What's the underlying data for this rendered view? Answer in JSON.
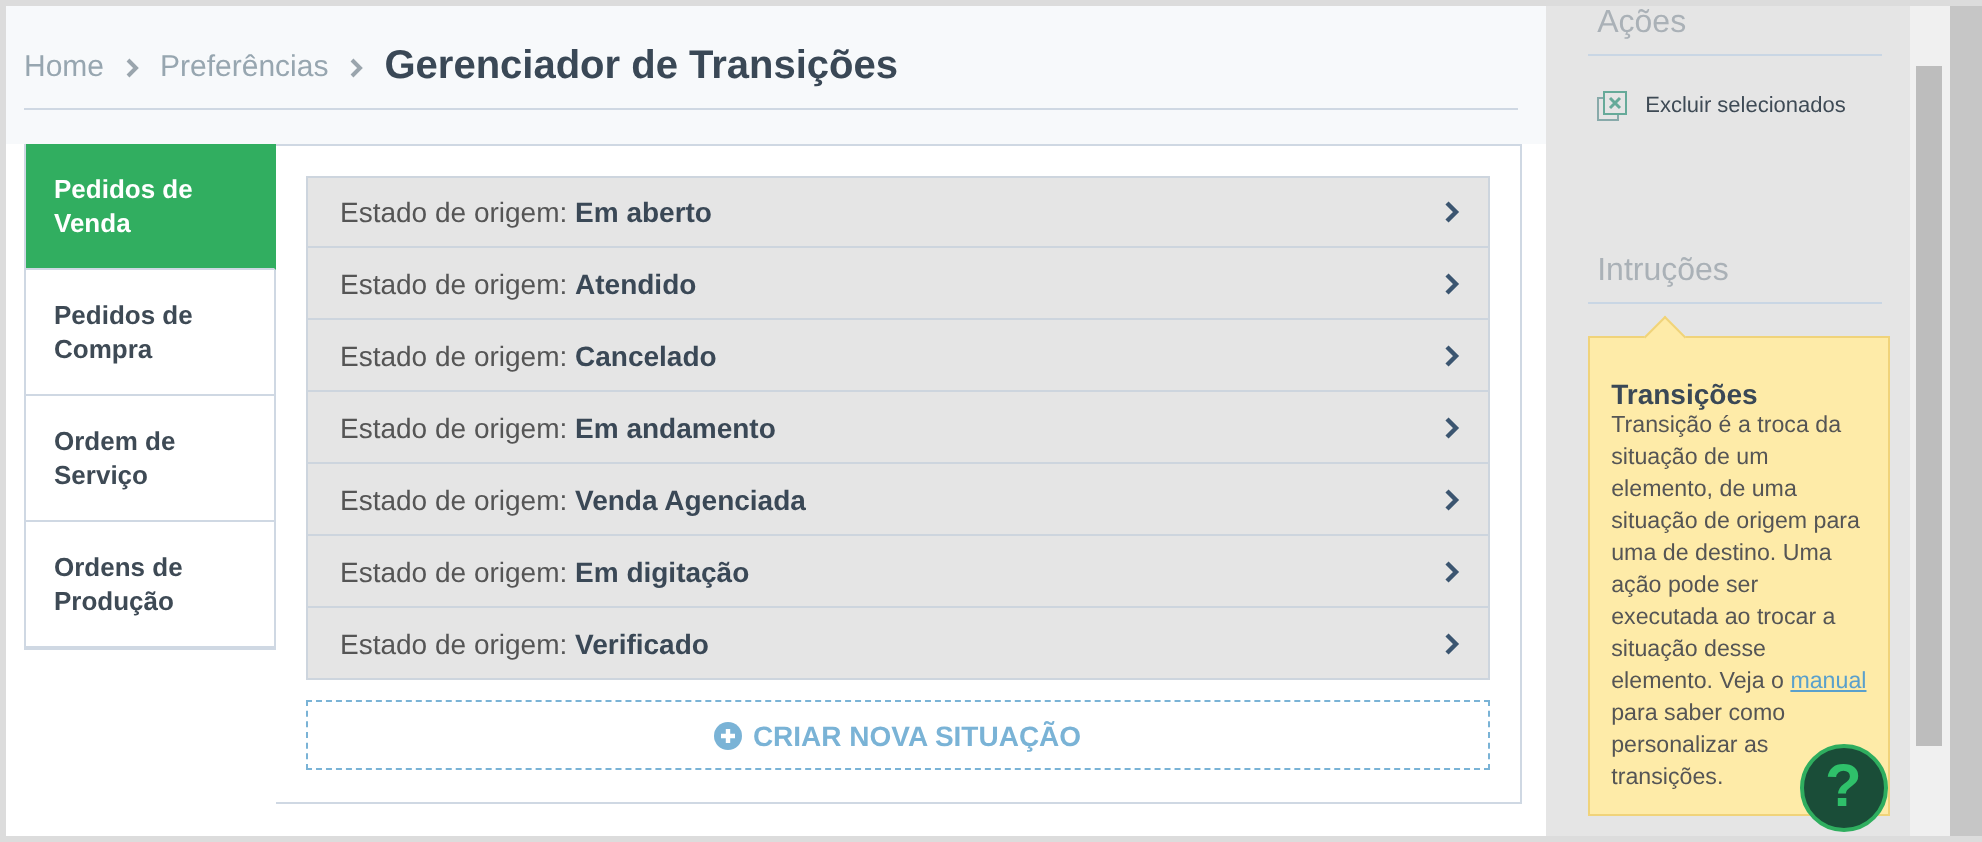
{
  "breadcrumb": {
    "items": [
      "Home",
      "Preferências"
    ],
    "title": "Gerenciador de Transições"
  },
  "tabs": [
    {
      "label": "Pedidos de Venda",
      "selected": true
    },
    {
      "label": "Pedidos de Compra",
      "selected": false
    },
    {
      "label": "Ordem de Serviço",
      "selected": false
    },
    {
      "label": "Ordens de Produção",
      "selected": false
    }
  ],
  "states": [
    {
      "prefix": "Estado de origem:",
      "name": "Em aberto"
    },
    {
      "prefix": "Estado de origem:",
      "name": "Atendido"
    },
    {
      "prefix": "Estado de origem:",
      "name": "Cancelado"
    },
    {
      "prefix": "Estado de origem:",
      "name": "Em andamento"
    },
    {
      "prefix": "Estado de origem:",
      "name": "Venda Agenciada"
    },
    {
      "prefix": "Estado de origem:",
      "name": "Em digitação"
    },
    {
      "prefix": "Estado de origem:",
      "name": "Verificado"
    }
  ],
  "create_button": "CRIAR NOVA SITUAÇÃO",
  "sidebar": {
    "actions_title": "Ações",
    "actions": [
      "Excluir selecionados"
    ],
    "instructions_title": "Intruções",
    "tip": {
      "title": "Transições",
      "text_before": "Transição é a troca da situação de um elemento, de uma situação de origem para uma de destino. Uma ação pode ser executada ao trocar a situação desse elemento. Veja o",
      "link": "manual",
      "text_after": "para saber como",
      "tail": "personalizar as transições."
    },
    "help_button": "?"
  }
}
